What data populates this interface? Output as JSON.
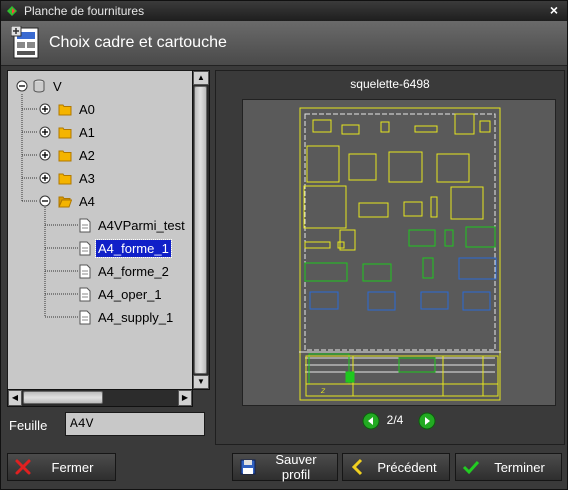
{
  "window": {
    "title": "Planche de fournitures",
    "close": "×"
  },
  "header": {
    "title": "Choix cadre et cartouche"
  },
  "tree": {
    "root": {
      "label": "V"
    },
    "folders": [
      {
        "label": "A0"
      },
      {
        "label": "A1"
      },
      {
        "label": "A2"
      },
      {
        "label": "A3"
      },
      {
        "label": "A4"
      }
    ],
    "files": [
      {
        "label": "A4VParmi_test",
        "selected": false
      },
      {
        "label": "A4_forme_1",
        "selected": true
      },
      {
        "label": "A4_forme_2",
        "selected": false
      },
      {
        "label": "A4_oper_1",
        "selected": false
      },
      {
        "label": "A4_supply_1",
        "selected": false
      }
    ]
  },
  "feuille": {
    "label": "Feuille",
    "value": "A4V"
  },
  "preview": {
    "title": "squelette-6498",
    "page": "2/4"
  },
  "buttons": {
    "close": "Fermer",
    "save": "Sauver profil",
    "prev": "Précédent",
    "finish": "Terminer"
  },
  "colors": {
    "frame": "#e6e61e",
    "green": "#1ec81e",
    "blue": "#2a6ad6",
    "selection": "#1020c8",
    "accent_green": "#22aa22"
  }
}
